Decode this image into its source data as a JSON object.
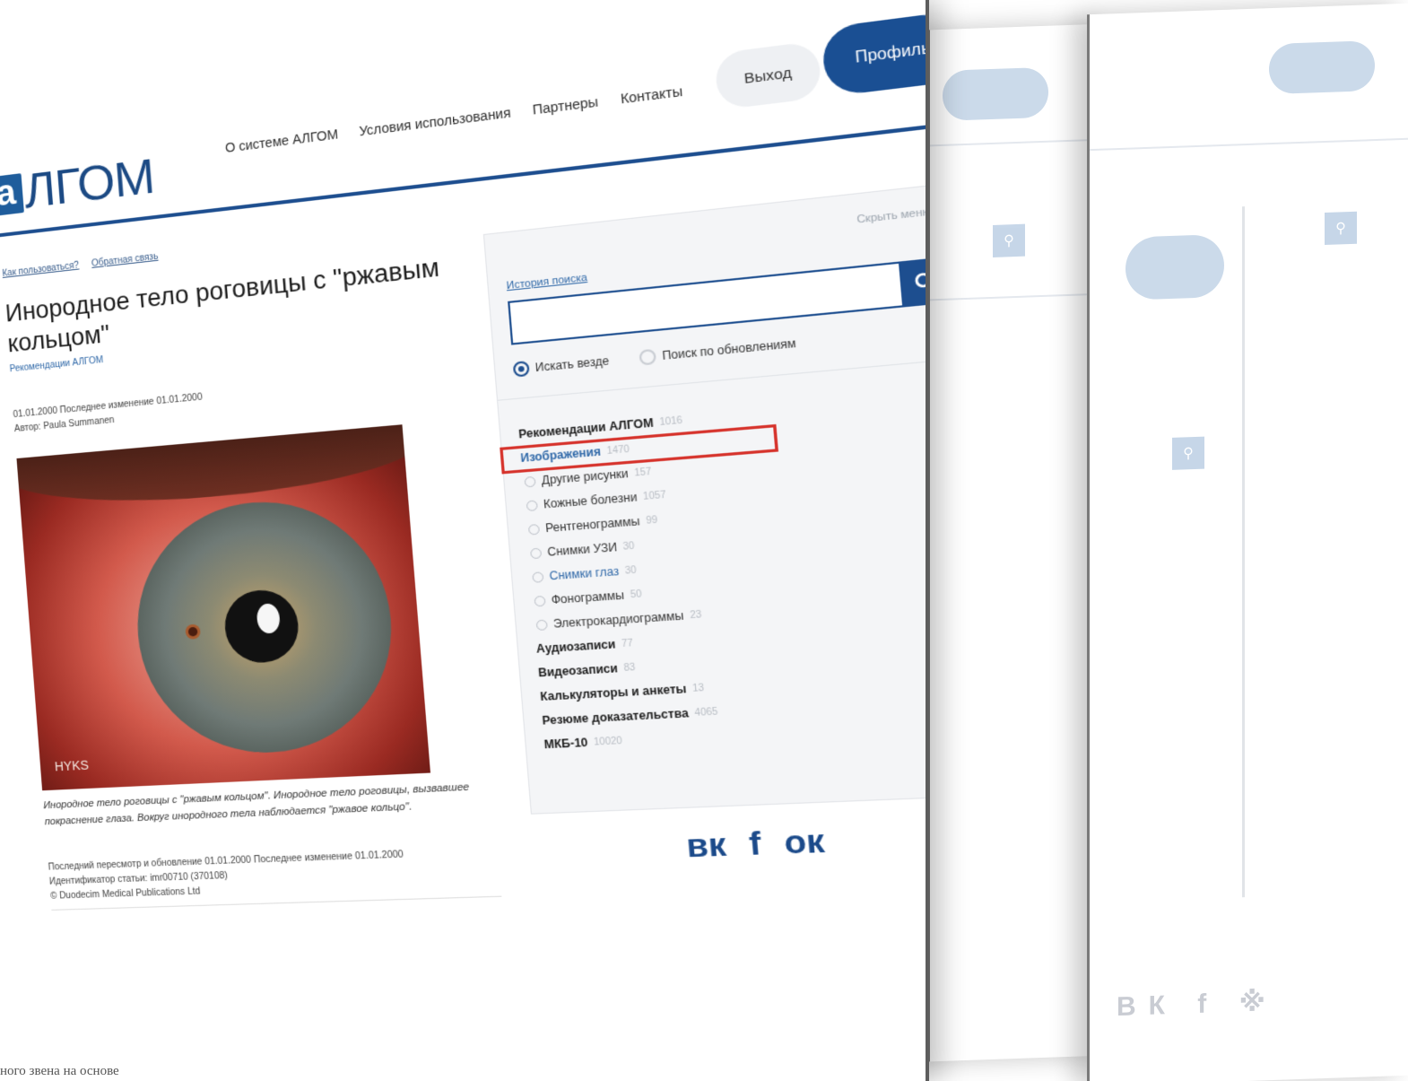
{
  "header": {
    "logo_mark": "а",
    "logo_text": "ЛГОМ",
    "nav": [
      "О системе АЛГОМ",
      "Условия использования",
      "Партнеры",
      "Контакты"
    ],
    "logout_label": "Выход",
    "profile_label": "Профиль",
    "accent_color": "#1d4e8f"
  },
  "article": {
    "help_links": [
      "Как пользоваться?",
      "Обратная связь"
    ],
    "title": "Инородное тело роговицы с \"ржавым кольцом\"",
    "subtitle": "Рекомендации АЛГОМ",
    "meta_line1": "01.01.2000   Последнее изменение 01.01.2000",
    "meta_line2": "Автор: Paula Summanen",
    "image_label": "HYKS",
    "caption": "Инородное тело роговицы с \"ржавым кольцом\". Инородное тело роговицы, вызвавшее покраснение глаза. Вокруг инородного тела наблюдается \"ржавое кольцо\".",
    "footer_line1": "Последний пересмотр и обновление 01.01.2000   Последнее изменение 01.01.2000",
    "footer_line2": "Идентификатор статьи: imr00710 (370108)",
    "footer_line3": "© Duodecim Medical Publications Ltd"
  },
  "panel": {
    "hide_menu": "Скрыть меню ^",
    "history_link": "История поиска",
    "search_value": "",
    "radio_all": "Искать везде",
    "radio_updates": "Поиск по обновлениям",
    "categories": [
      {
        "label": "Рекомендации АЛГОМ",
        "count": "1016",
        "level": 0
      },
      {
        "label": "Изображения",
        "count": "1470",
        "level": 0,
        "active": true
      },
      {
        "label": "Другие рисунки",
        "count": "157",
        "level": 1
      },
      {
        "label": "Кожные болезни",
        "count": "1057",
        "level": 1
      },
      {
        "label": "Рентгенограммы",
        "count": "99",
        "level": 1
      },
      {
        "label": "Снимки УЗИ",
        "count": "30",
        "level": 1
      },
      {
        "label": "Снимки глаз",
        "count": "30",
        "level": 1,
        "active": true
      },
      {
        "label": "Фонограммы",
        "count": "50",
        "level": 1
      },
      {
        "label": "Электрокардиограммы",
        "count": "23",
        "level": 1
      },
      {
        "label": "Аудиозаписи",
        "count": "77",
        "level": 0
      },
      {
        "label": "Видеозаписи",
        "count": "83",
        "level": 0
      },
      {
        "label": "Калькуляторы и анкеты",
        "count": "13",
        "level": 0
      },
      {
        "label": "Резюме доказательства",
        "count": "4065",
        "level": 0
      },
      {
        "label": "МКБ-10",
        "count": "10020",
        "level": 0
      }
    ]
  },
  "social": [
    "вк",
    "f",
    "ок"
  ],
  "bottom_text": "ного звена на основе"
}
